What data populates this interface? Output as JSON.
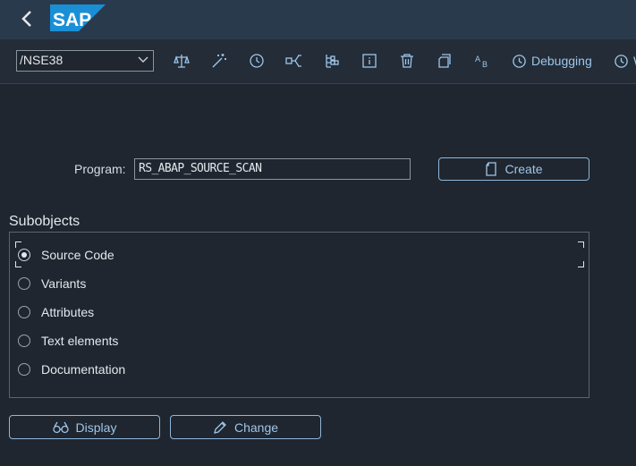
{
  "shell": {
    "logo_text": "SAP",
    "brand_color": "#1a8fd6"
  },
  "toolbar": {
    "tcode_value": "/NSE38",
    "icons": [
      "check-syntax-icon",
      "activate-icon",
      "test-run-icon",
      "where-used-icon",
      "hierarchy-icon",
      "info-icon",
      "delete-icon",
      "copy-icon",
      "rename-icon"
    ],
    "debugging_label": "Debugging",
    "overflow_label": "W"
  },
  "form": {
    "program_label": "Program:",
    "program_value": "RS_ABAP_SOURCE_SCAN",
    "create_label": "Create"
  },
  "subobjects": {
    "title": "Subobjects",
    "options": [
      {
        "label": "Source Code",
        "checked": true
      },
      {
        "label": "Variants",
        "checked": false
      },
      {
        "label": "Attributes",
        "checked": false
      },
      {
        "label": "Text elements",
        "checked": false
      },
      {
        "label": "Documentation",
        "checked": false
      }
    ]
  },
  "actions": {
    "display_label": "Display",
    "change_label": "Change"
  }
}
